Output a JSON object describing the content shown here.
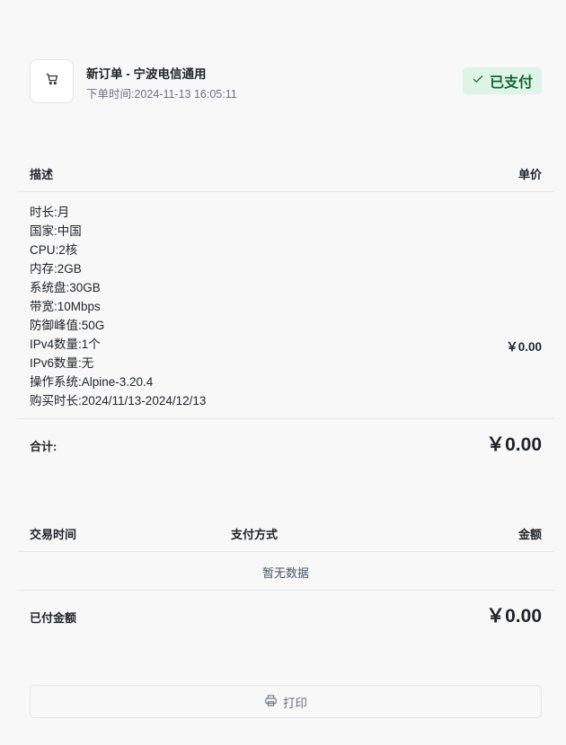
{
  "order": {
    "title": "新订单 - 宁波电信通用",
    "time_label": "下单时间:",
    "time_value": "2024-11-13 16:05:11",
    "status": "已支付",
    "icon": "cart-icon",
    "status_icon": "check-icon",
    "status_color": "#166534"
  },
  "items_table": {
    "headers": {
      "description": "描述",
      "unit_price": "单价"
    },
    "rows": [
      {
        "details": [
          "时长:月",
          "国家:中国",
          "CPU:2核",
          "内存:2GB",
          "系统盘:30GB",
          "带宽:10Mbps",
          "防御峰值:50G",
          "IPv4数量:1个",
          "IPv6数量:无",
          "操作系统:Alpine-3.20.4",
          "购买时长:2024/11/13-2024/12/13"
        ],
        "price": "￥0.00"
      }
    ],
    "total_label": "合计:",
    "total_value": "￥0.00"
  },
  "transactions_table": {
    "headers": {
      "time": "交易时间",
      "method": "支付方式",
      "amount": "金额"
    },
    "empty_text": "暂无数据",
    "paid_label": "已付金额",
    "paid_value": "￥0.00"
  },
  "actions": {
    "print_label": "打印",
    "print_icon": "printer-icon"
  }
}
